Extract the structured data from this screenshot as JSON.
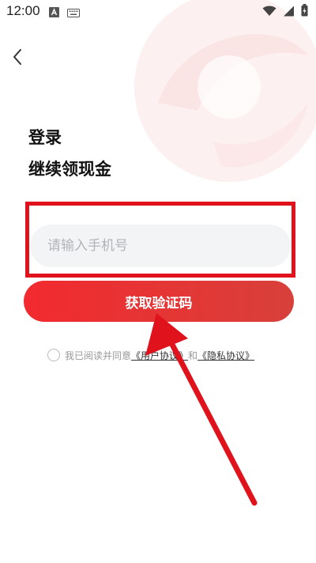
{
  "status_bar": {
    "time": "12:00",
    "left_icons": [
      "app-a-icon",
      "keyboard-icon"
    ],
    "right_icons": [
      "wifi-icon",
      "signal-icon",
      "battery-icon"
    ]
  },
  "nav": {
    "back_icon": "chevron-left-icon"
  },
  "heading": {
    "line1": "登录",
    "line2": "继续领现金"
  },
  "phone": {
    "placeholder": "请输入手机号",
    "value": ""
  },
  "submit": {
    "label": "获取验证码"
  },
  "agreement": {
    "prefix": "我已阅读并同意",
    "user_agreement": "《用户协议》",
    "and": "和",
    "privacy_policy": "《隐私协议》",
    "checked": false
  },
  "colors": {
    "accent": "#f22a2f",
    "annotation": "#e0121c",
    "input_bg": "#f3f4f6"
  }
}
